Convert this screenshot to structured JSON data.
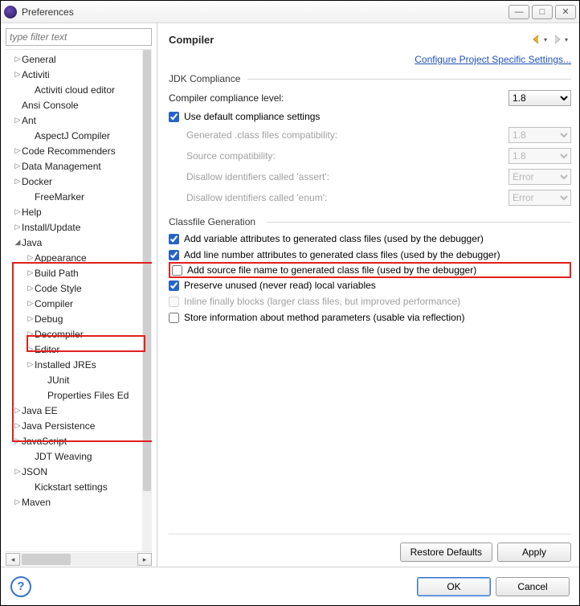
{
  "window": {
    "title": "Preferences"
  },
  "filter": {
    "placeholder": "type filter text"
  },
  "tree": [
    {
      "d": 0,
      "a": "▷",
      "t": "General"
    },
    {
      "d": 0,
      "a": "▷",
      "t": "Activiti"
    },
    {
      "d": 1,
      "a": "",
      "t": "Activiti cloud editor"
    },
    {
      "d": 0,
      "a": "",
      "t": "Ansi Console"
    },
    {
      "d": 0,
      "a": "▷",
      "t": "Ant"
    },
    {
      "d": 1,
      "a": "",
      "t": "AspectJ Compiler"
    },
    {
      "d": 0,
      "a": "▷",
      "t": "Code Recommenders"
    },
    {
      "d": 0,
      "a": "▷",
      "t": "Data Management"
    },
    {
      "d": 0,
      "a": "▷",
      "t": "Docker"
    },
    {
      "d": 1,
      "a": "",
      "t": "FreeMarker"
    },
    {
      "d": 0,
      "a": "▷",
      "t": "Help"
    },
    {
      "d": 0,
      "a": "▷",
      "t": "Install/Update"
    },
    {
      "d": 0,
      "a": "◢",
      "t": "Java"
    },
    {
      "d": 1,
      "a": "▷",
      "t": "Appearance"
    },
    {
      "d": 1,
      "a": "▷",
      "t": "Build Path"
    },
    {
      "d": 1,
      "a": "▷",
      "t": "Code Style"
    },
    {
      "d": 1,
      "a": "▷",
      "t": "Compiler",
      "sel": true
    },
    {
      "d": 1,
      "a": "▷",
      "t": "Debug"
    },
    {
      "d": 1,
      "a": "▷",
      "t": "Decompiler"
    },
    {
      "d": 1,
      "a": "▷",
      "t": "Editor"
    },
    {
      "d": 1,
      "a": "▷",
      "t": "Installed JREs"
    },
    {
      "d": 2,
      "a": "",
      "t": "JUnit"
    },
    {
      "d": 2,
      "a": "",
      "t": "Properties Files Ed"
    },
    {
      "d": 0,
      "a": "▷",
      "t": "Java EE"
    },
    {
      "d": 0,
      "a": "▷",
      "t": "Java Persistence"
    },
    {
      "d": 0,
      "a": "▷",
      "t": "JavaScript"
    },
    {
      "d": 1,
      "a": "",
      "t": "JDT Weaving"
    },
    {
      "d": 0,
      "a": "▷",
      "t": "JSON"
    },
    {
      "d": 1,
      "a": "",
      "t": "Kickstart settings"
    },
    {
      "d": 0,
      "a": "▷",
      "t": "Maven"
    }
  ],
  "page": {
    "title": "Compiler",
    "link": "Configure Project Specific Settings...",
    "jdk": {
      "title": "JDK Compliance",
      "level_label": "Compiler compliance level:",
      "level_value": "1.8",
      "use_default": "Use default compliance settings",
      "gen_label": "Generated .class files compatibility:",
      "gen_value": "1.8",
      "src_label": "Source compatibility:",
      "src_value": "1.8",
      "assert_label": "Disallow identifiers called 'assert':",
      "assert_value": "Error",
      "enum_label": "Disallow identifiers called 'enum':",
      "enum_value": "Error"
    },
    "cf": {
      "title": "Classfile Generation",
      "c1": "Add variable attributes to generated class files (used by the debugger)",
      "c2": "Add line number attributes to generated class files (used by the debugger)",
      "c3": "Add source file name to generated class file (used by the debugger)",
      "c4": "Preserve unused (never read) local variables",
      "c5": "Inline finally blocks (larger class files, but improved performance)",
      "c6": "Store information about method parameters (usable via reflection)"
    },
    "restore": "Restore Defaults",
    "apply": "Apply"
  },
  "footer": {
    "ok": "OK",
    "cancel": "Cancel"
  }
}
